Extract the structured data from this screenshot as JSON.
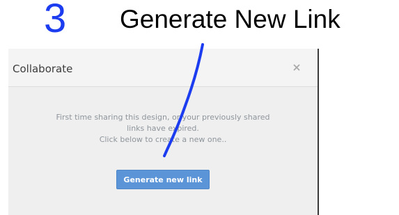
{
  "annotation": {
    "step_number": "3",
    "caption": "Generate New Link",
    "colors": {
      "step_number": "#1c3cf0",
      "stroke": "#1c3cf0"
    }
  },
  "dialog": {
    "title": "Collaborate",
    "close_icon": "close-icon",
    "message_lines": [
      "First time sharing this design, or your previously shared",
      "links have expired.",
      "Click below to create a new one.."
    ],
    "generate_button_label": "Generate new link",
    "colors": {
      "button": "#5b94d7",
      "message_text": "#8e959b"
    }
  }
}
